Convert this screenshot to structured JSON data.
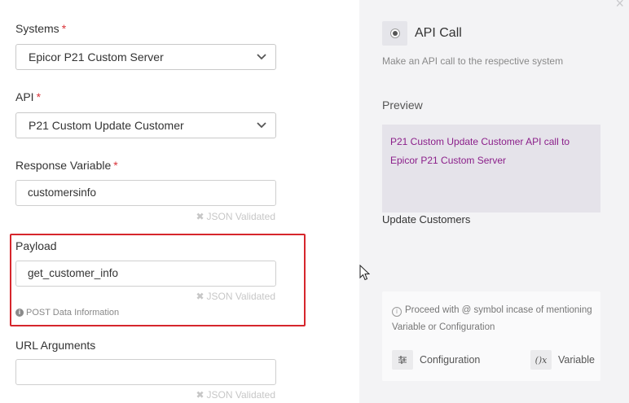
{
  "form": {
    "systems": {
      "label": "Systems",
      "required_mark": "*",
      "value": "Epicor P21 Custom Server"
    },
    "api": {
      "label": "API",
      "required_mark": "*",
      "value": "P21 Custom Update Customer"
    },
    "response_variable": {
      "label": "Response Variable",
      "required_mark": "*",
      "value": "customersinfo",
      "validation": "JSON Validated"
    },
    "payload": {
      "label": "Payload",
      "value": "get_customer_info",
      "validation": "JSON Validated",
      "info": "POST Data Information"
    },
    "url_arguments": {
      "label": "URL Arguments",
      "value": "",
      "validation": "JSON Validated"
    }
  },
  "side_panel": {
    "close_symbol": "×",
    "action": {
      "title": "API Call",
      "description": "Make an API call to the respective system",
      "icon": "radio-icon"
    },
    "preview": {
      "label": "Preview",
      "line1": "P21 Custom Update Customer API call to",
      "line2": "Epicor P21 Custom Server",
      "accent_color": "#8b1f8a"
    },
    "node_name": "Update Customers",
    "help": {
      "text": "Proceed with @ symbol incase of mentioning Variable or Configuration",
      "configuration_label": "Configuration",
      "configuration_icon": "sliders-icon",
      "variable_label": "Variable",
      "variable_icon": "variable-fx-icon"
    }
  },
  "colors": {
    "required": "#d9343a",
    "highlight_border": "#d6262c",
    "panel_bg": "#f3f3f5"
  }
}
